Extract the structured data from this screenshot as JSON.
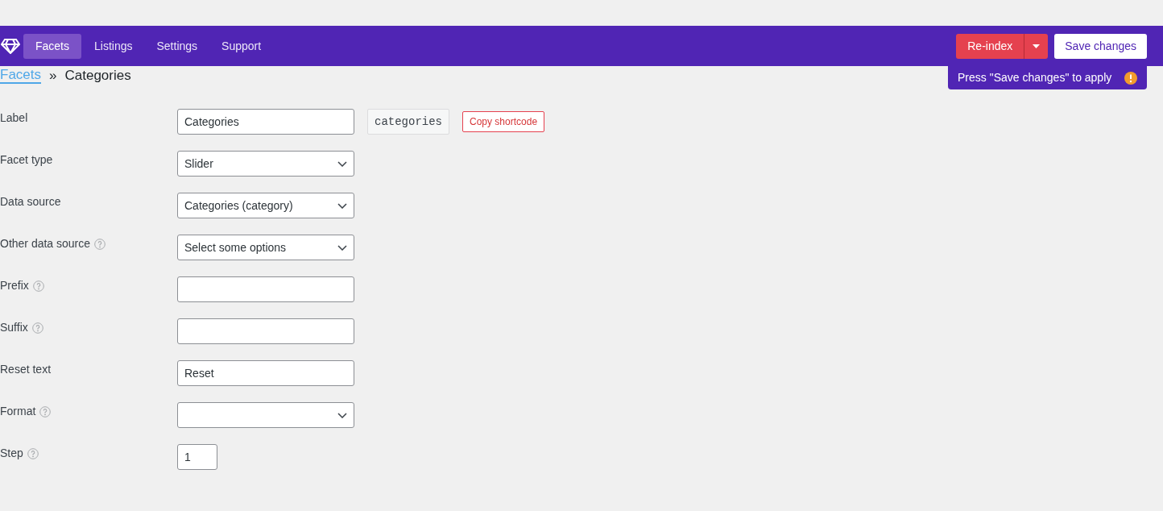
{
  "nav": {
    "tabs": [
      {
        "label": "Facets",
        "selected": true
      },
      {
        "label": "Listings",
        "selected": false
      },
      {
        "label": "Settings",
        "selected": false
      },
      {
        "label": "Support",
        "selected": false
      }
    ],
    "reindex_button": "Re-index",
    "save_button": "Save changes",
    "notice": "Press \"Save changes\" to apply"
  },
  "breadcrumb": {
    "link": "Facets",
    "separator": "»",
    "current": "Categories"
  },
  "fields": [
    {
      "label": "Label",
      "help": false,
      "kind": "text",
      "value": "Categories",
      "shortcode": "categories",
      "copy_button": "Copy shortcode"
    },
    {
      "label": "Facet type",
      "help": false,
      "kind": "select",
      "value": "Slider"
    },
    {
      "label": "Data source",
      "help": false,
      "kind": "select",
      "value": "Categories (category)"
    },
    {
      "label": "Other data source",
      "help": true,
      "kind": "select",
      "value": "Select some options"
    },
    {
      "label": "Prefix",
      "help": true,
      "kind": "text"
    },
    {
      "label": "Suffix",
      "help": true,
      "kind": "text"
    },
    {
      "label": "Reset text",
      "help": false,
      "kind": "text",
      "value": "Reset"
    },
    {
      "label": "Format",
      "help": true,
      "kind": "select"
    },
    {
      "label": "Step",
      "help": true,
      "kind": "number",
      "value": "1"
    }
  ]
}
